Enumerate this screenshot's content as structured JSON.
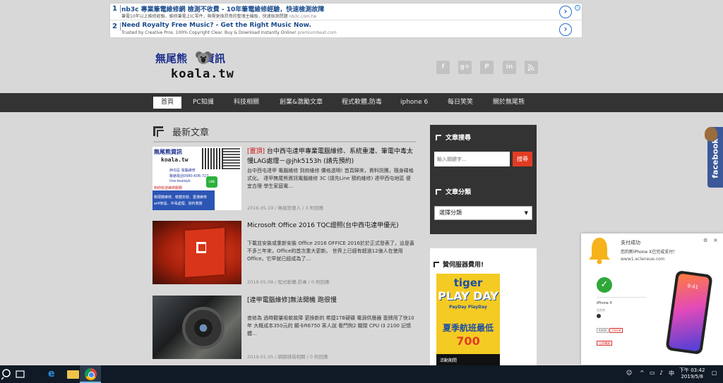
{
  "ads": [
    {
      "number": "1",
      "title": "nb3c 專業筆電維修網 檢測不收費 - 10年筆電維修經驗，快速檢測故障",
      "description": "筆電10年以上維修經驗，維修筆電上IC零件，無需更換昂貴的整塊主機板，快速檢測問題",
      "url": "nb3c.com.tw"
    },
    {
      "number": "2",
      "title": "Need Royalty Free Music? - Get the Right Music Now.",
      "description": "Trusted by Creative Pros. 100% Copyright Clear. Buy & Download Instantly Online!",
      "url": "premiumbeat.com"
    }
  ],
  "ad_arrow": "›",
  "ad_info": "i",
  "logo": {
    "top": "無尾熊",
    "top_right": "資訊",
    "bottom": "koala.tw"
  },
  "social": [
    "f",
    "g+",
    "P",
    "in",
    "rss"
  ],
  "nav": [
    "首頁",
    "PC知識",
    "科技相關",
    "創業&激勵文章",
    "程式軟體,防毒",
    "iphone 6",
    "每日笑笑",
    "關於無尾熊"
  ],
  "section_title": "最新文章",
  "posts": [
    {
      "pin": "[置頂]",
      "title": " 台中西屯達甲專業電腦維修、系統重灌、筆電中毒太慢LAG處理－@jhk5153h (請先預約)",
      "excerpt": "台中西屯達甲 電腦維修 到府維修 價格透明! 首頁歸來，資料訊團，隨身碟格式化。 達甲無尾熊資訊電腦維修 3C (請先Line 預約維修) 達甲西屯地區 便宜合理 學生家庭電…",
      "meta": "2016.05.19 / 無尾熊個人 / 3 則回應"
    },
    {
      "title": "Microsoft Office 2016 TQC證照(台中西屯達甲優光)",
      "excerpt": "下載並安裝或重新安裝 Office 2016 OFFICE 2016於於正式發表了，這是蓋不多三年來，Office的首次重大更新。 世界上已經有超過12億人在使用Office，它早就已經成為了…",
      "meta": "2019.05.08 / 程式軟體,防毒 / 0 則回應"
    },
    {
      "title": "[達甲電腦維修]無法開機 跑很慢",
      "excerpt": "查修為 過時觀量吸軟故障 更換新的 希捷1TB硬碟 電源供應器 簽牌用了快10年 大概成本350元的 顯卡R6750 客人說 看門狗2 關閉 CPU I3 2100 記憶體…",
      "meta": "2019.01.05 / 網路錢借相關 / 0 則回應"
    }
  ],
  "thumb1": {
    "logo": "無尾熊資訊",
    "koala": "koala.tw",
    "lines": [
      "西屯區 電腦維修",
      "聯絡電話0980-606-727",
      "line:koalayk"
    ],
    "red": "到府收送維修服務",
    "bottom": [
      "軟硬體維修、軟體安裝、重灌維修",
      "wifi架設、中毒處理、資料救援"
    ],
    "line_badge": "LINE"
  },
  "sidebar": {
    "search_title": "文章搜尋",
    "search_placeholder": "輸入關鍵字...",
    "search_button": "搜尋",
    "category_title": "文章分類",
    "category_select": "選擇分類",
    "sponsor_title": "贊伺服器費用!"
  },
  "tiger_ad": {
    "brand": "tiger",
    "play": "PLAY DAY",
    "day": "PayDay PlayDay",
    "sale": "夏季航班最低",
    "price": "700",
    "bottom": "活動期間"
  },
  "facebook_tab": "facebook",
  "notification": {
    "title": "支付成功",
    "message": "您的新iPhone X已完成支付！",
    "url": "www1.ecleneue.com",
    "product": "iPhone X",
    "color_label": "太空灰",
    "options": [
      "64GB",
      "256GB"
    ],
    "button": "立即購買",
    "phone_time": "9:41",
    "close": "×",
    "gear": "⚙"
  },
  "taskbar": {
    "time": "下午 03:42",
    "date": "2019/5/8",
    "ime": "中"
  }
}
